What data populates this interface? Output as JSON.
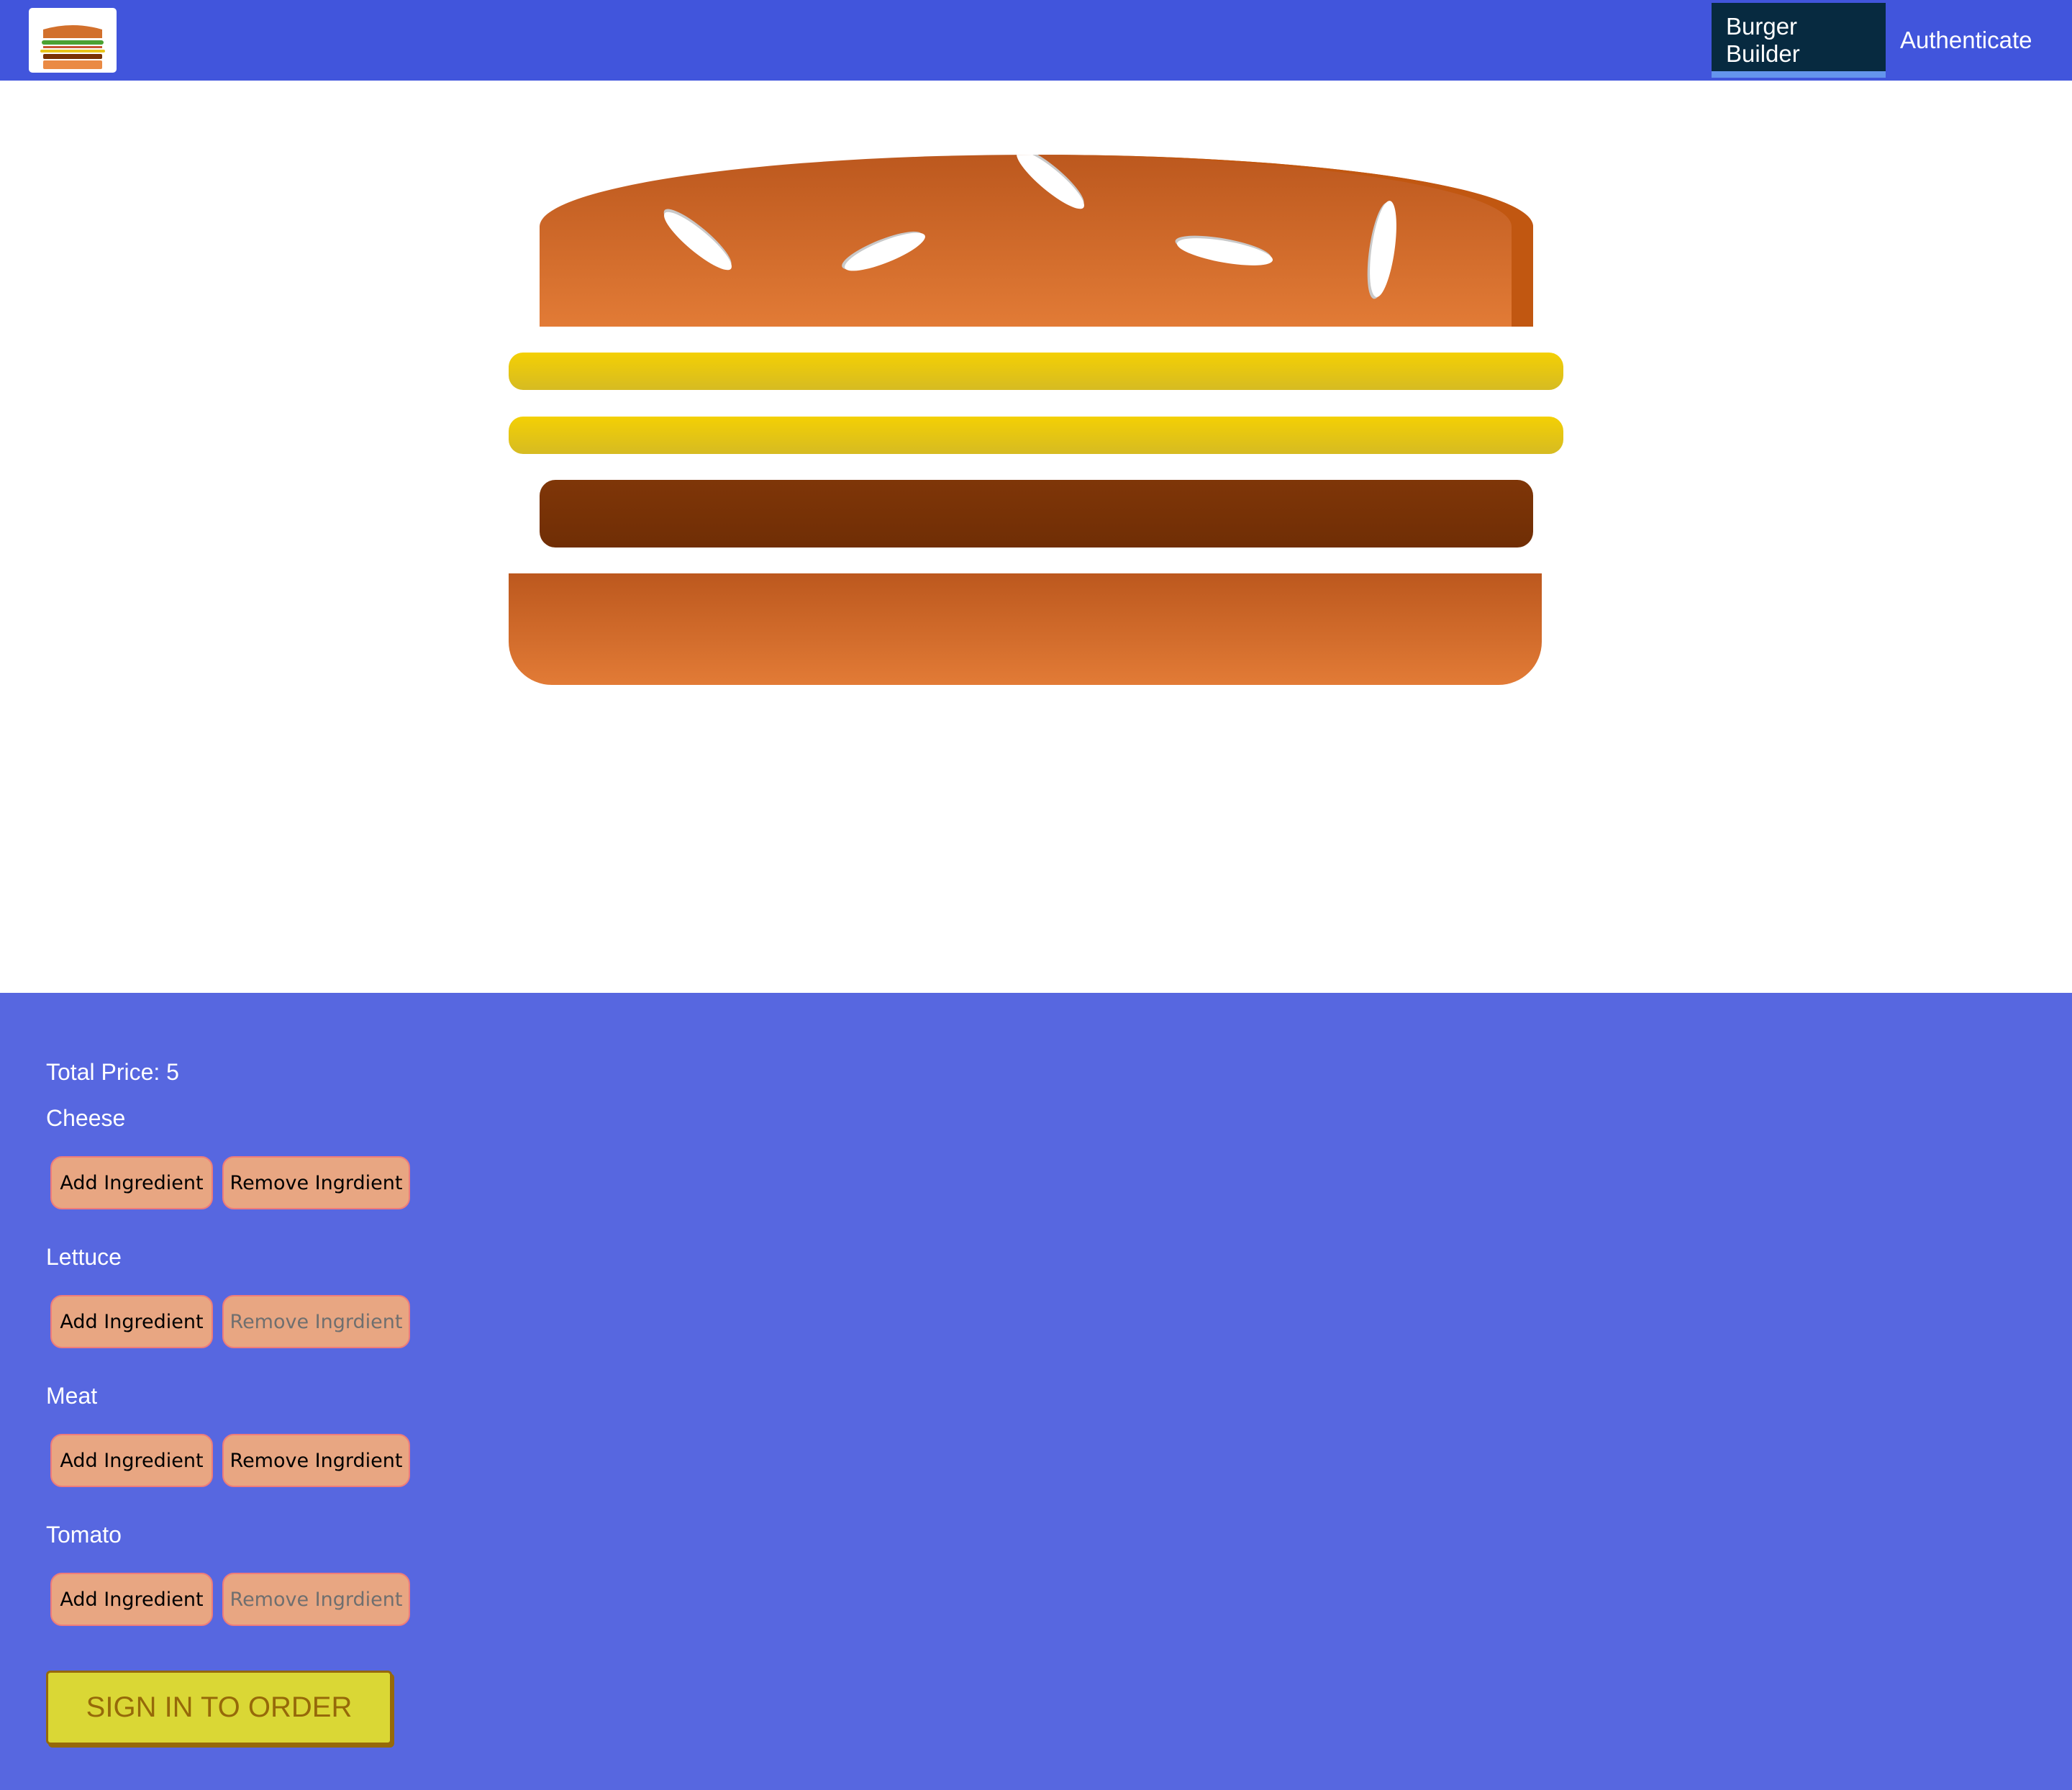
{
  "header": {
    "logo_icon": "burger-logo",
    "nav": [
      {
        "label": "Burger Builder",
        "active": true
      },
      {
        "label": "Authenticate",
        "active": false
      }
    ]
  },
  "burger": {
    "layers": [
      "bread-top",
      "cheese",
      "cheese",
      "meat",
      "bread-bottom"
    ]
  },
  "controls": {
    "total_price_label": "Total Price: 5",
    "ingredients": [
      {
        "label": "Cheese",
        "add": "Add Ingredient",
        "remove": "Remove Ingrdient",
        "remove_disabled": false
      },
      {
        "label": "Lettuce",
        "add": "Add Ingredient",
        "remove": "Remove Ingrdient",
        "remove_disabled": true
      },
      {
        "label": "Meat",
        "add": "Add Ingredient",
        "remove": "Remove Ingrdient",
        "remove_disabled": false
      },
      {
        "label": "Tomato",
        "add": "Add Ingredient",
        "remove": "Remove Ingrdient",
        "remove_disabled": true
      }
    ],
    "order_button": "SIGN IN TO ORDER"
  },
  "colors": {
    "header": "#4155DC",
    "controls_bg": "#5767E0",
    "button": "#E8A682",
    "order_button": "#DAD735"
  }
}
